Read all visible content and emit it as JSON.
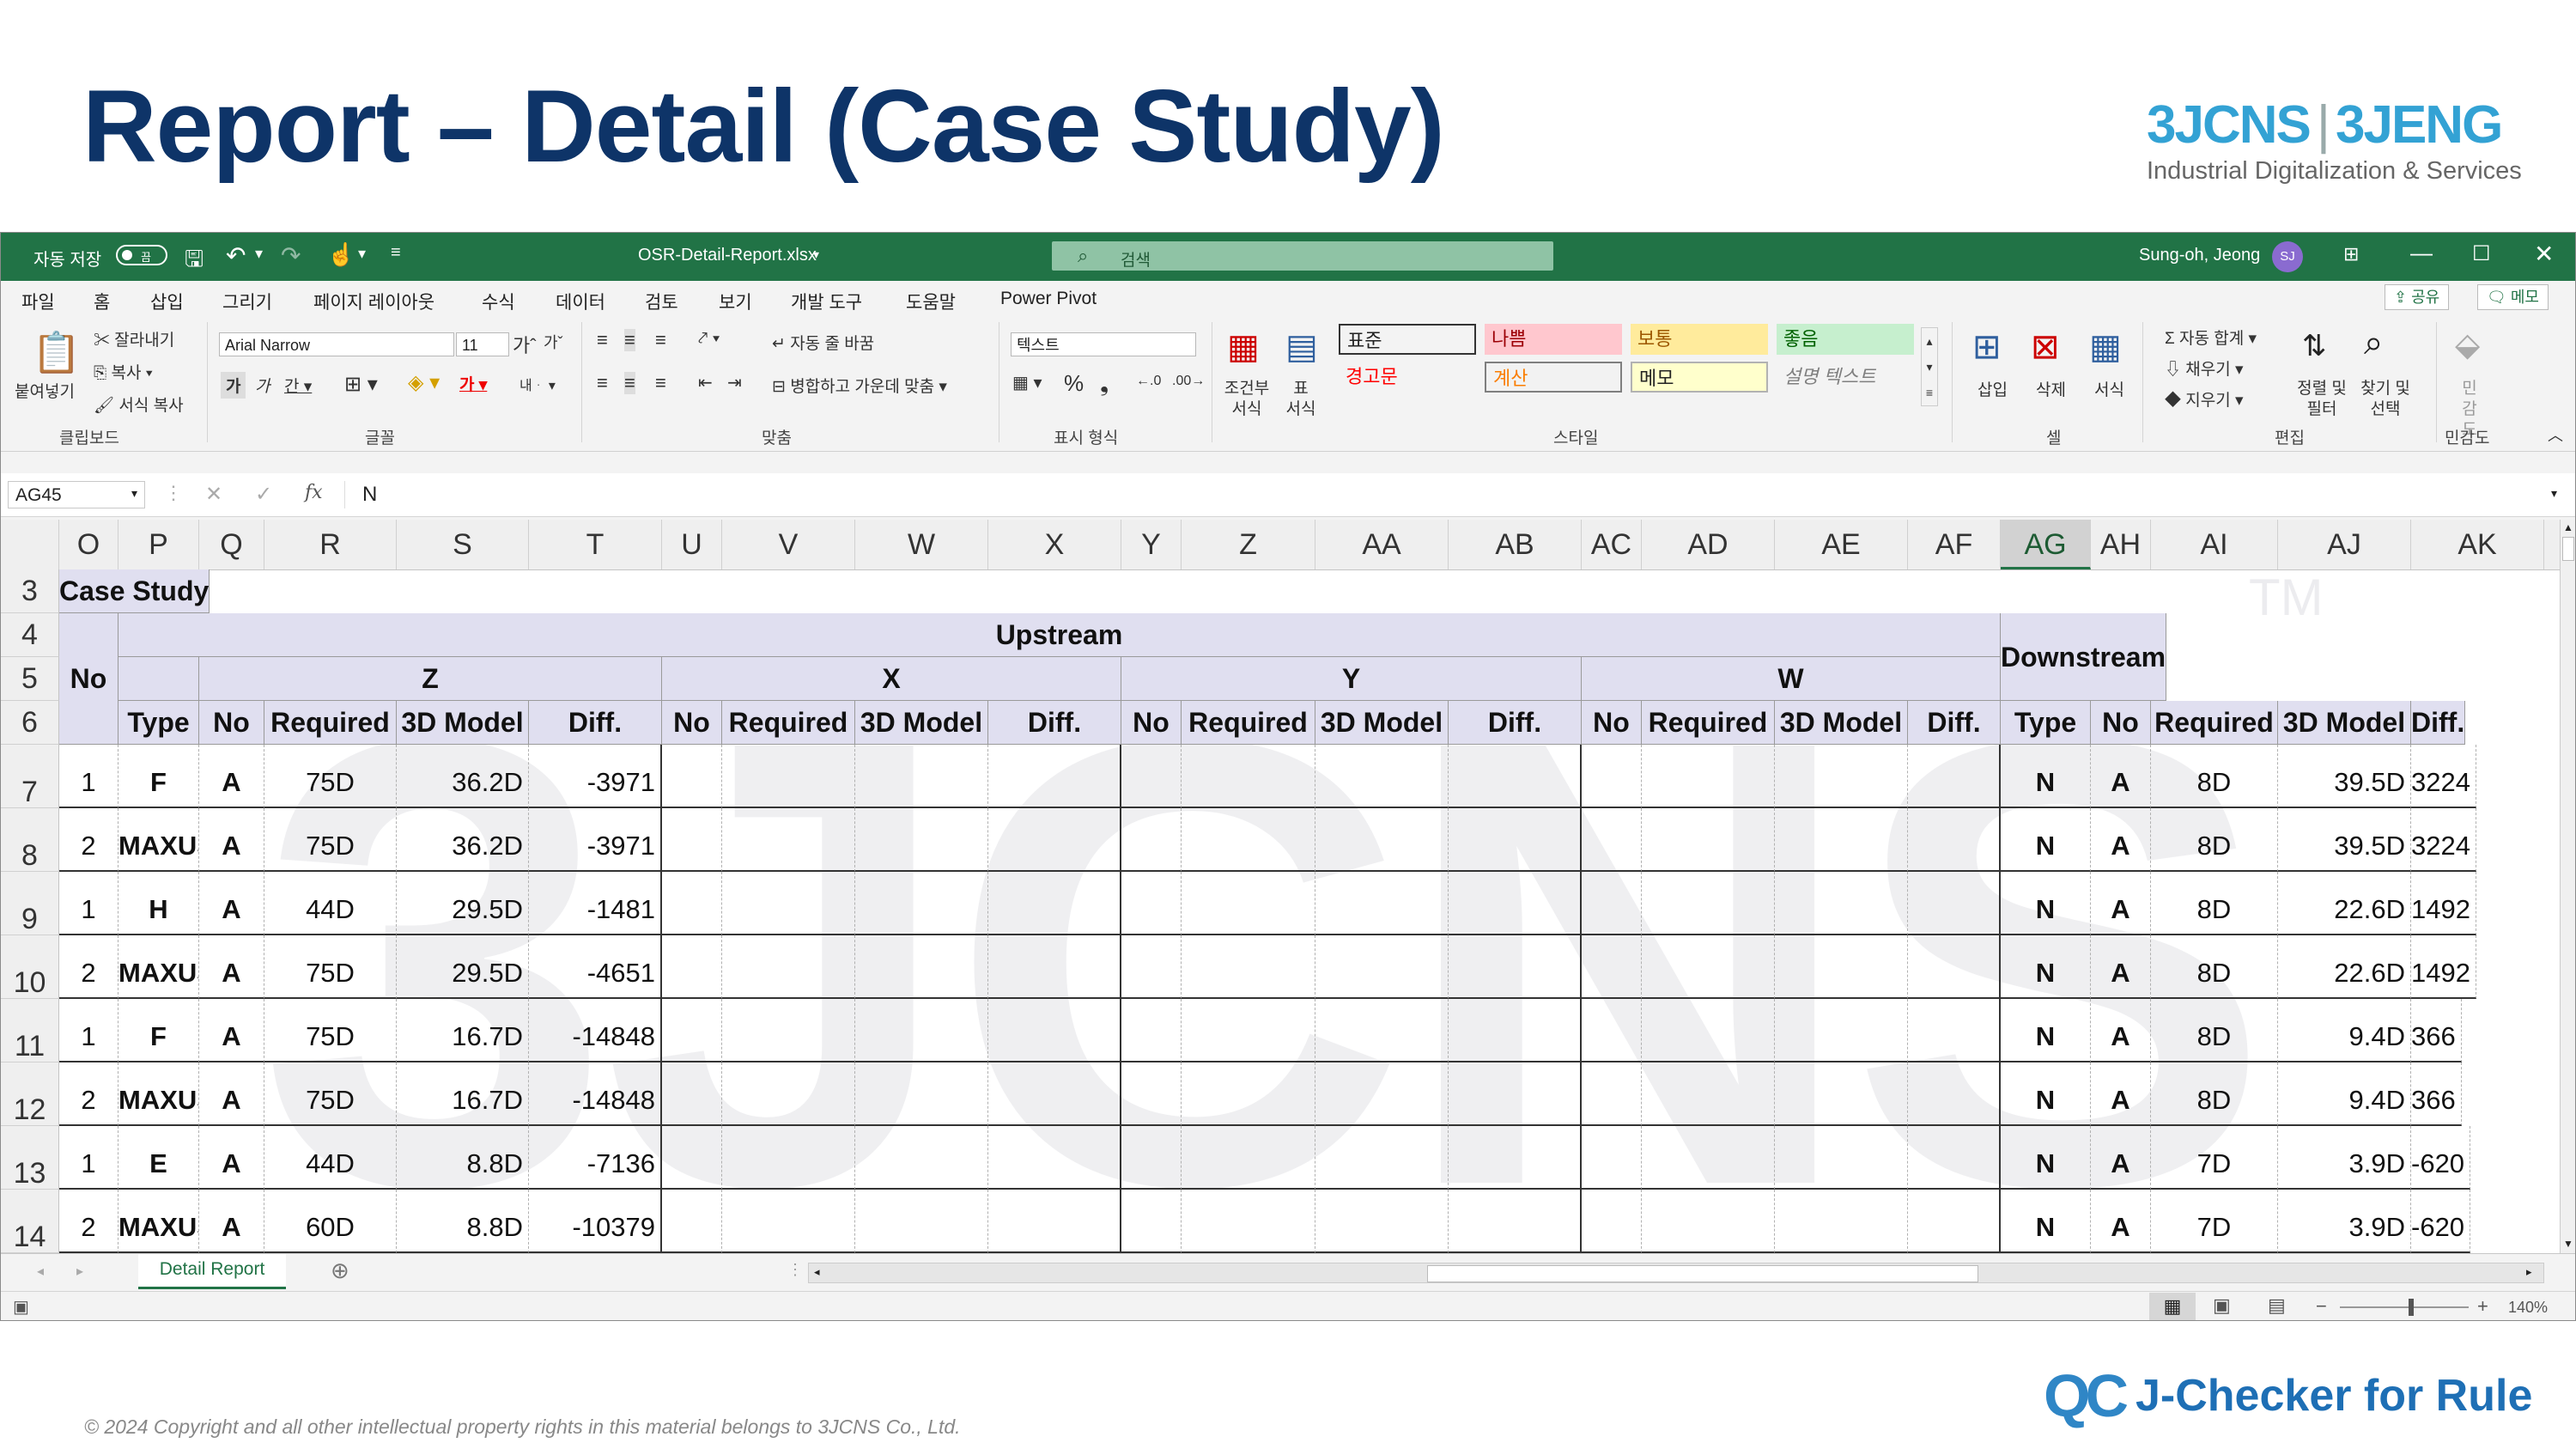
{
  "slide": {
    "title": "Report – Detail (Case Study)",
    "logo_left": "3JCNS",
    "logo_right": "3JENG",
    "logo_tagline": "Industrial Digitalization & Services",
    "copyright": "© 2024 Copyright and all other intellectual property rights in this material belongs to 3JCNS Co., Ltd.",
    "product_mark": "QC",
    "product_name": "J-Checker for Rule"
  },
  "titlebar": {
    "autosave_label": "자동 저장",
    "autosave_state": "끔",
    "filename": "OSR-Detail-Report.xlsx",
    "search_placeholder": "검색",
    "user_name": "Sung-oh, Jeong",
    "user_initials": "SJ"
  },
  "menu": {
    "items": [
      "파일",
      "홈",
      "삽입",
      "그리기",
      "페이지 레이아웃",
      "수식",
      "데이터",
      "검토",
      "보기",
      "개발 도구",
      "도움말",
      "Power Pivot"
    ],
    "active": "홈",
    "share_label": "공유",
    "memo_label": "메모"
  },
  "ribbon": {
    "clipboard": {
      "paste": "붙여넣기",
      "cut": "잘라내기",
      "copy": "복사",
      "format_painter": "서식 복사",
      "label": "클립보드"
    },
    "font": {
      "font_name": "Arial Narrow",
      "font_size": "11",
      "label": "글꼴"
    },
    "alignment": {
      "wrap": "자동 줄 바꿈",
      "merge": "병합하고 가운데 맞춤",
      "label": "맞춤"
    },
    "number": {
      "format": "텍스트",
      "label": "표시 형식"
    },
    "styles": {
      "conditional": "조건부 서식",
      "table": "표 서식",
      "cells": [
        {
          "label": "표준",
          "bg": "#ffffff",
          "fg": "#000000"
        },
        {
          "label": "나쁨",
          "bg": "#ffc7ce",
          "fg": "#9c0006"
        },
        {
          "label": "보통",
          "bg": "#ffeb9c",
          "fg": "#9c5700"
        },
        {
          "label": "좋음",
          "bg": "#c6efce",
          "fg": "#006100"
        },
        {
          "label": "경고문",
          "bg": "#ffffff",
          "fg": "#ff0000"
        },
        {
          "label": "계산",
          "bg": "#f2f2f2",
          "fg": "#fa7d00"
        },
        {
          "label": "메모",
          "bg": "#ffffcc",
          "fg": "#000000"
        },
        {
          "label": "설명 텍스트",
          "bg": "#ffffff",
          "fg": "#7f7f7f"
        }
      ],
      "label": "스타일"
    },
    "cells": {
      "insert": "삽입",
      "delete": "삭제",
      "format": "서식",
      "label": "셀"
    },
    "editing": {
      "autosum": "자동 합계",
      "fill": "채우기",
      "clear": "지우기",
      "sort": "정렬 및 필터",
      "find": "찾기 및 선택",
      "label": "편집"
    },
    "sensitivity": {
      "button": "민감도",
      "label": "민감도"
    }
  },
  "formula_bar": {
    "name_box": "AG45",
    "fx": "fx",
    "value": "N"
  },
  "columns": [
    "O",
    "P",
    "Q",
    "R",
    "S",
    "T",
    "U",
    "V",
    "W",
    "X",
    "Y",
    "Z",
    "AA",
    "AB",
    "AC",
    "AD",
    "AE",
    "AF",
    "AG",
    "AH",
    "AI",
    "AJ",
    "AK"
  ],
  "selected_column": "AG",
  "row_numbers": [
    "3",
    "4",
    "5",
    "6",
    "7",
    "8",
    "9",
    "10",
    "11",
    "12",
    "13",
    "14"
  ],
  "sheet": {
    "watermark": "3JCNS",
    "case_study": "Case Study",
    "upstream": "Upstream",
    "downstream": "Downstream",
    "no": "No",
    "groups": [
      "Z",
      "X",
      "Y",
      "W"
    ],
    "type_col": "Type",
    "up_cols": [
      "No",
      "Required",
      "3D Model",
      "Diff."
    ],
    "down_cols": [
      "Type",
      "No",
      "Required",
      "3D Model",
      "Diff."
    ],
    "rows": [
      {
        "no": "1",
        "type": "F",
        "no2": "A",
        "required": "75D",
        "model": "36.2D",
        "diff": "-3971",
        "d_type": "N",
        "d_no": "A",
        "d_required": "8D",
        "d_model": "39.5D",
        "d_diff": "3224"
      },
      {
        "no": "2",
        "type": "MAXUS",
        "no2": "A",
        "required": "75D",
        "model": "36.2D",
        "diff": "-3971",
        "d_type": "N",
        "d_no": "A",
        "d_required": "8D",
        "d_model": "39.5D",
        "d_diff": "3224"
      },
      {
        "no": "1",
        "type": "H",
        "no2": "A",
        "required": "44D",
        "model": "29.5D",
        "diff": "-1481",
        "d_type": "N",
        "d_no": "A",
        "d_required": "8D",
        "d_model": "22.6D",
        "d_diff": "1492"
      },
      {
        "no": "2",
        "type": "MAXUS",
        "no2": "A",
        "required": "75D",
        "model": "29.5D",
        "diff": "-4651",
        "d_type": "N",
        "d_no": "A",
        "d_required": "8D",
        "d_model": "22.6D",
        "d_diff": "1492"
      },
      {
        "no": "1",
        "type": "F",
        "no2": "A",
        "required": "75D",
        "model": "16.7D",
        "diff": "-14848",
        "d_type": "N",
        "d_no": "A",
        "d_required": "8D",
        "d_model": "9.4D",
        "d_diff": "366"
      },
      {
        "no": "2",
        "type": "MAXUS",
        "no2": "A",
        "required": "75D",
        "model": "16.7D",
        "diff": "-14848",
        "d_type": "N",
        "d_no": "A",
        "d_required": "8D",
        "d_model": "9.4D",
        "d_diff": "366"
      },
      {
        "no": "1",
        "type": "E",
        "no2": "A",
        "required": "44D",
        "model": "8.8D",
        "diff": "-7136",
        "d_type": "N",
        "d_no": "A",
        "d_required": "7D",
        "d_model": "3.9D",
        "d_diff": "-620"
      },
      {
        "no": "2",
        "type": "MAXUS",
        "no2": "A",
        "required": "60D",
        "model": "8.8D",
        "diff": "-10379",
        "d_type": "N",
        "d_no": "A",
        "d_required": "7D",
        "d_model": "3.9D",
        "d_diff": "-620"
      }
    ]
  },
  "sheet_tab": "Detail Report",
  "status": {
    "zoom": "140%"
  },
  "colors": {
    "excel_green": "#217346",
    "title_blue": "#0e3468",
    "header_fill": "#e0dff0"
  }
}
